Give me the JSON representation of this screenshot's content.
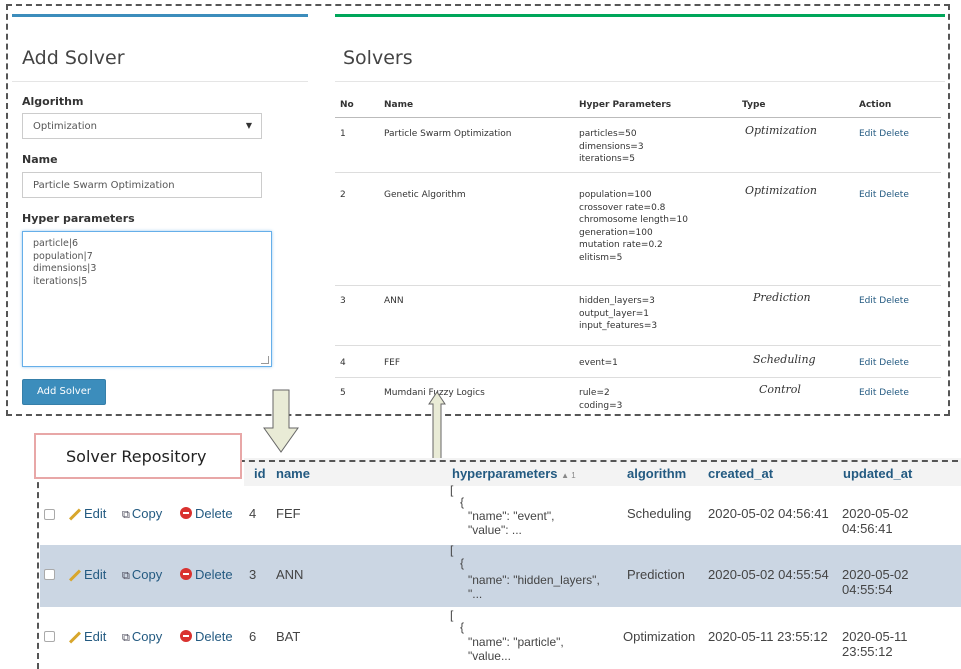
{
  "add_solver": {
    "title": "Add Solver",
    "algorithm_label": "Algorithm",
    "algorithm_value": "Optimization",
    "name_label": "Name",
    "name_value": "Particle Swarm Optimization",
    "hyper_label": "Hyper parameters",
    "hyper_lines": [
      "particle|6",
      "population|7",
      "dimensions|3",
      "iterations|5"
    ],
    "button": "Add Solver"
  },
  "solvers": {
    "title": "Solvers",
    "headers": {
      "no": "No",
      "name": "Name",
      "hyper": "Hyper Parameters",
      "type": "Type",
      "action": "Action"
    },
    "rows": [
      {
        "no": "1",
        "name": "Particle Swarm Optimization",
        "hyper": [
          "particles=50",
          "dimensions=3",
          "iterations=5"
        ],
        "type": "Optimization",
        "action": "Edit Delete"
      },
      {
        "no": "2",
        "name": "Genetic Algorithm",
        "hyper": [
          "population=100",
          "crossover rate=0.8",
          "chromosome length=10",
          "generation=100",
          "mutation rate=0.2",
          "elitism=5"
        ],
        "type": "Optimization",
        "action": "Edit Delete"
      },
      {
        "no": "3",
        "name": "ANN",
        "hyper": [
          "hidden_layers=3",
          "output_layer=1",
          "input_features=3"
        ],
        "type": "Prediction",
        "action": "Edit Delete"
      },
      {
        "no": "4",
        "name": "FEF",
        "hyper": [
          "event=1"
        ],
        "type": "Scheduling",
        "action": "Edit Delete"
      },
      {
        "no": "5",
        "name": "Mumdani Fuzzy Logics",
        "hyper": [
          "rule=2",
          "coding=3"
        ],
        "type": "Control",
        "action": "Edit Delete"
      }
    ]
  },
  "repository": {
    "label": "Solver Repository",
    "headers": {
      "id": "id",
      "name": "name",
      "hyper": "hyperparameters",
      "sort_mark": "▲ 1",
      "algorithm": "algorithm",
      "created": "created_at",
      "updated": "updated_at"
    },
    "actions": {
      "edit": "Edit",
      "copy": "Copy",
      "delete": "Delete"
    },
    "rows": [
      {
        "id": "4",
        "name": "FEF",
        "json": [
          "[",
          "{",
          "\"name\": \"event\",",
          "\"value\": ..."
        ],
        "algorithm": "Scheduling",
        "created": "2020-05-02 04:56:41",
        "updated": "2020-05-02 04:56:41"
      },
      {
        "id": "3",
        "name": "ANN",
        "json": [
          "[",
          "{",
          "\"name\": \"hidden_layers\",",
          "\"..."
        ],
        "algorithm": "Prediction",
        "created": "2020-05-02 04:55:54",
        "updated": "2020-05-02 04:55:54"
      },
      {
        "id": "6",
        "name": "BAT",
        "json": [
          "[",
          "{",
          "\"name\": \"particle\",",
          "\"value..."
        ],
        "algorithm": "Optimization",
        "created": "2020-05-11 23:55:12",
        "updated": "2020-05-11 23:55:12"
      }
    ]
  }
}
